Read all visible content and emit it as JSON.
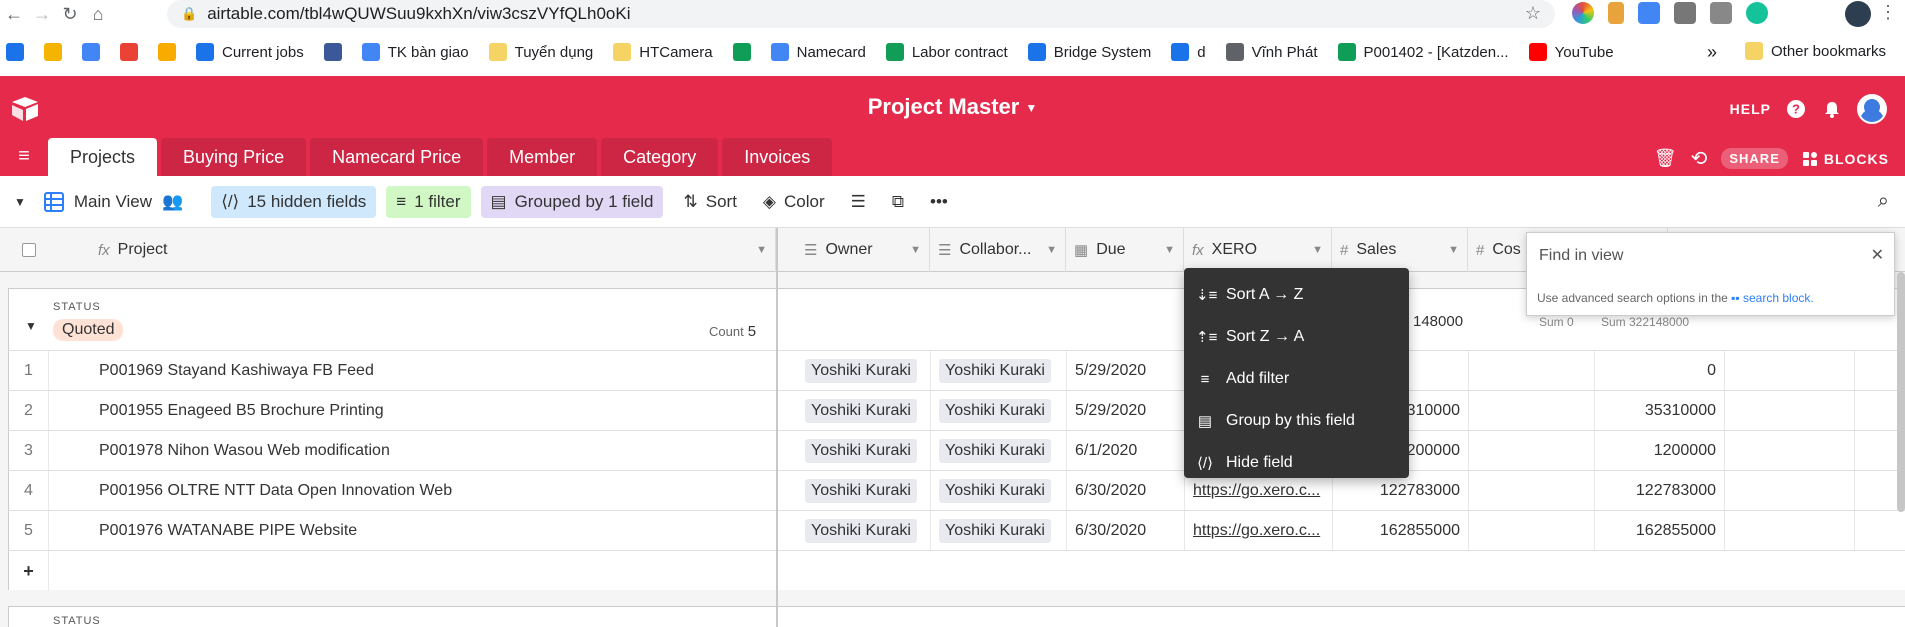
{
  "browser": {
    "url": "airtable.com/tbl4wQUWSuu9kxhXn/viw3cszVYfQLh0oKi",
    "bookmarks": [
      {
        "label": "",
        "color": "#1a73e8"
      },
      {
        "label": "",
        "color": "#f4b400"
      },
      {
        "label": "",
        "color": "#4285f4"
      },
      {
        "label": "",
        "color": "#ea4335"
      },
      {
        "label": "",
        "color": "#f9ab00"
      },
      {
        "label": "Current jobs",
        "color": "#1a73e8"
      },
      {
        "label": "",
        "color": "#3b5998"
      },
      {
        "label": "TK bàn giao",
        "color": "#4285f4"
      },
      {
        "label": "Tuyển dụng",
        "color": "#f6d365"
      },
      {
        "label": "HTCamera",
        "color": "#f6d365"
      },
      {
        "label": "",
        "color": "#0f9d58"
      },
      {
        "label": "Namecard",
        "color": "#4285f4"
      },
      {
        "label": "Labor contract",
        "color": "#0f9d58"
      },
      {
        "label": "Bridge System",
        "color": "#1a73e8"
      },
      {
        "label": "d",
        "color": "#1a73e8"
      },
      {
        "label": "Vĩnh Phát",
        "color": "#5f6368"
      },
      {
        "label": "P001402 - [Katzden...",
        "color": "#0f9d58"
      },
      {
        "label": "YouTube",
        "color": "#ff0000"
      }
    ],
    "more": "»",
    "other_bookmarks": "Other bookmarks"
  },
  "app": {
    "base_title": "Project Master",
    "help": "HELP",
    "share": "SHARE",
    "blocks": "BLOCKS",
    "brand_color": "#e52a4c"
  },
  "tabs": [
    {
      "label": "Projects",
      "active": true
    },
    {
      "label": "Buying Price"
    },
    {
      "label": "Namecard Price"
    },
    {
      "label": "Member"
    },
    {
      "label": "Category"
    },
    {
      "label": "Invoices"
    }
  ],
  "viewbar": {
    "view_name": "Main View",
    "hidden_fields": "15 hidden fields",
    "filter": "1 filter",
    "grouped": "Grouped by 1 field",
    "sort": "Sort",
    "color": "Color"
  },
  "columns": {
    "project": "Project",
    "owner": "Owner",
    "collaborator": "Collabor...",
    "due": "Due",
    "xero": "XERO",
    "sales": "Sales",
    "cost": "Cos"
  },
  "group": {
    "label": "STATUS",
    "value": "Quoted",
    "count_label": "Count",
    "count": "5",
    "sales_partial": "148000",
    "sum_cost": "Sum 0",
    "sum_other": "Sum 322148000",
    "next_label": "STATUS"
  },
  "rows": [
    {
      "n": "1",
      "project": "P001969 Stayand Kashiwaya FB Feed",
      "owner": "Yoshiki Kuraki",
      "collab": "Yoshiki Kuraki",
      "due": "5/29/2020",
      "xero": "",
      "sales": "",
      "last": "0"
    },
    {
      "n": "2",
      "project": "P001955 Enageed B5 Brochure Printing",
      "owner": "Yoshiki Kuraki",
      "collab": "Yoshiki Kuraki",
      "due": "5/29/2020",
      "xero": "",
      "sales": "310000",
      "last": "35310000"
    },
    {
      "n": "3",
      "project": "P001978 Nihon Wasou Web modification",
      "owner": "Yoshiki Kuraki",
      "collab": "Yoshiki Kuraki",
      "due": "6/1/2020",
      "xero": "",
      "sales": "200000",
      "last": "1200000"
    },
    {
      "n": "4",
      "project": "P001956 OLTRE NTT Data Open Innovation Web",
      "owner": "Yoshiki Kuraki",
      "collab": "Yoshiki Kuraki",
      "due": "6/30/2020",
      "xero": "https://go.xero.c...",
      "sales": "122783000",
      "last": "122783000"
    },
    {
      "n": "5",
      "project": "P001976 WATANABE PIPE Website",
      "owner": "Yoshiki Kuraki",
      "collab": "Yoshiki Kuraki",
      "due": "6/30/2020",
      "xero": "https://go.xero.c...",
      "sales": "162855000",
      "last": "162855000"
    }
  ],
  "context_menu": [
    {
      "icon": "sort-asc-icon",
      "label": "Sort A → Z"
    },
    {
      "icon": "sort-desc-icon",
      "label": "Sort Z → A"
    },
    {
      "icon": "filter-icon",
      "label": "Add filter"
    },
    {
      "icon": "group-icon",
      "label": "Group by this field"
    },
    {
      "icon": "hide-icon",
      "label": "Hide field"
    }
  ],
  "find": {
    "title": "Find in view",
    "hint": "Use advanced search options in the",
    "link": "search block."
  }
}
